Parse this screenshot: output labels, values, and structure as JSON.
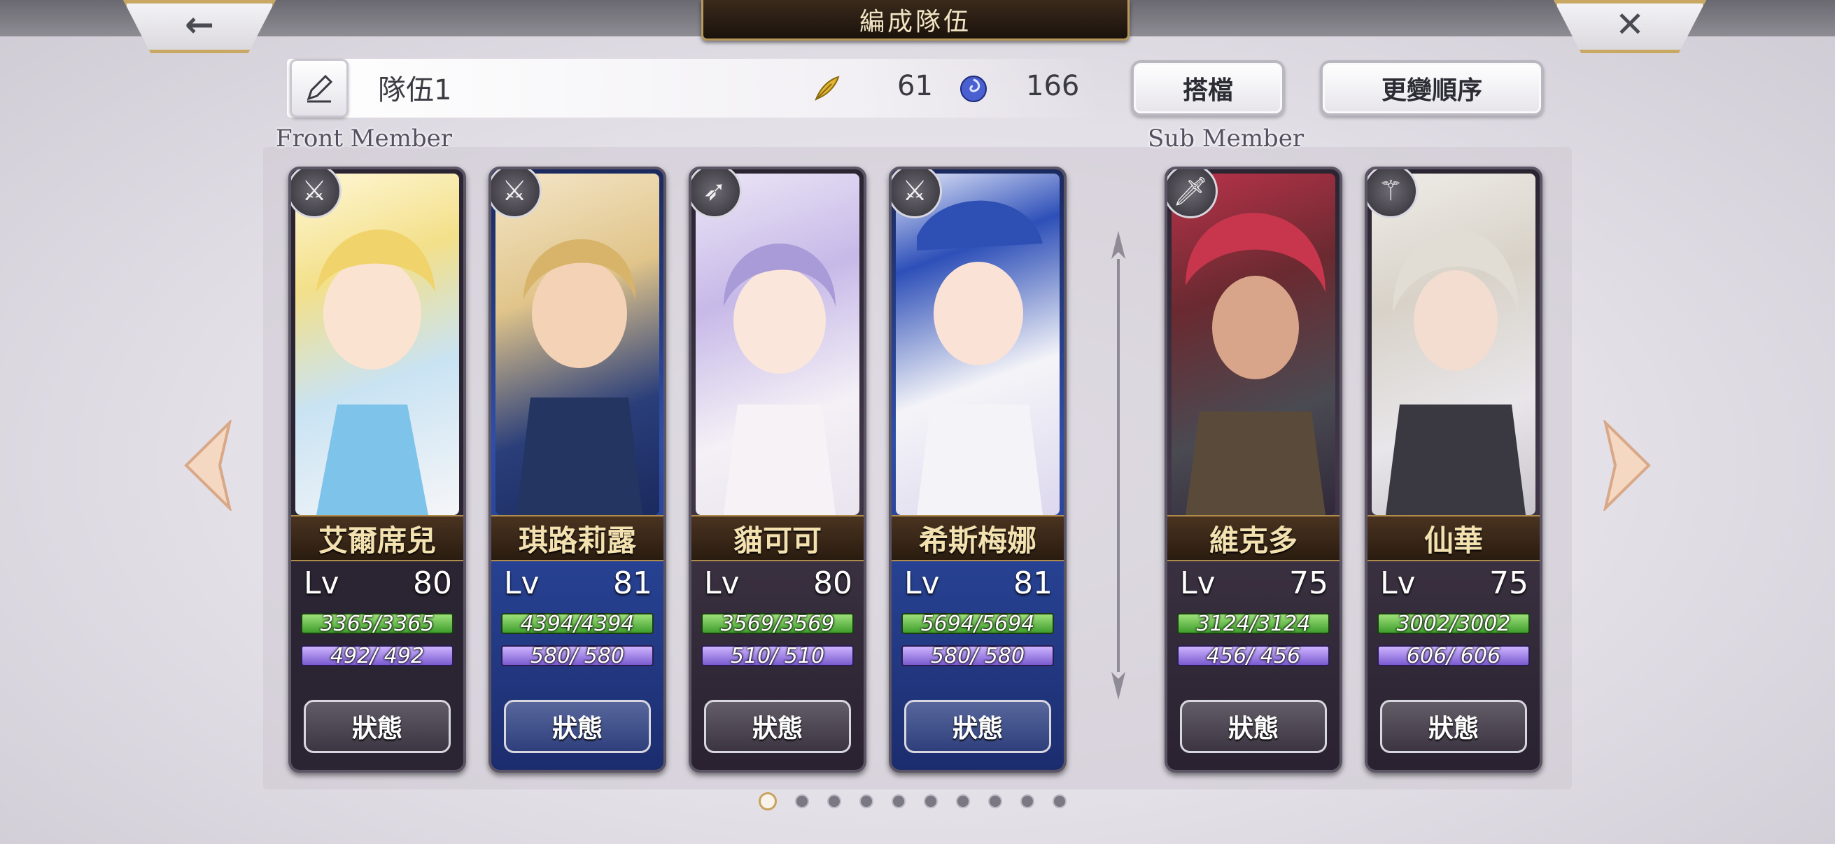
{
  "header": {
    "title": "編成隊伍",
    "back_glyph": "←",
    "close_glyph": "✕"
  },
  "team": {
    "name": "隊伍1",
    "feather_count": "61",
    "orb_count": "166"
  },
  "buttons": {
    "partner": "搭檔",
    "reorder": "更變順序"
  },
  "sections": {
    "front": "Front Member",
    "sub": "Sub Member"
  },
  "members": [
    {
      "name": "艾爾席兒",
      "lv_label": "Lv",
      "lv": "80",
      "hp": "3365/3365",
      "mp": "492/ 492",
      "status": "狀態",
      "weapon": "sword-icon"
    },
    {
      "name": "琪路莉露",
      "lv_label": "Lv",
      "lv": "81",
      "hp": "4394/4394",
      "mp": "580/ 580",
      "status": "狀態",
      "weapon": "sword-icon"
    },
    {
      "name": "貓可可",
      "lv_label": "Lv",
      "lv": "80",
      "hp": "3569/3569",
      "mp": "510/ 510",
      "status": "狀態",
      "weapon": "bow-icon"
    },
    {
      "name": "希斯梅娜",
      "lv_label": "Lv",
      "lv": "81",
      "hp": "5694/5694",
      "mp": "580/ 580",
      "status": "狀態",
      "weapon": "sword-icon"
    },
    {
      "name": "維克多",
      "lv_label": "Lv",
      "lv": "75",
      "hp": "3124/3124",
      "mp": "456/ 456",
      "status": "狀態",
      "weapon": "blade-icon"
    },
    {
      "name": "仙華",
      "lv_label": "Lv",
      "lv": "75",
      "hp": "3002/3002",
      "mp": "606/ 606",
      "status": "狀態",
      "weapon": "staff-icon"
    }
  ],
  "pager": {
    "total": 10,
    "active": 1
  },
  "colors": {
    "gold": "#c8a25e",
    "hp": "#3f9e2c",
    "mp": "#7b5bd0"
  }
}
